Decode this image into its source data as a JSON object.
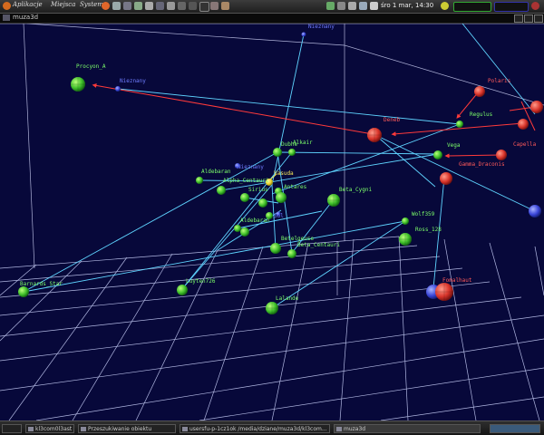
{
  "top_panel": {
    "menus": [
      "Aplikacje",
      "Miejsca",
      "System"
    ],
    "clock": "śro 1 mar, 14:30"
  },
  "window": {
    "title": "muza3d"
  },
  "taskbar": {
    "tasks": [
      "kl3com0l3ast",
      "Przeszukiwanie obiektu",
      "usersfu-p-1cz1ok /media/dziane/muza3d/kl3com...",
      "muza3d"
    ]
  },
  "stars": [
    {
      "name": "Procyon_A",
      "color": "green"
    },
    {
      "name": "Nieznany",
      "color": "blue"
    },
    {
      "name": "Nieznany",
      "color": "blue"
    },
    {
      "name": "Polaris",
      "color": "red"
    },
    {
      "name": "Regulus",
      "color": "green"
    },
    {
      "name": "Deneb",
      "color": "red"
    },
    {
      "name": "Vega",
      "color": "green"
    },
    {
      "name": "Capella",
      "color": "red"
    },
    {
      "name": "Gamma_Draconis",
      "color": "red"
    },
    {
      "name": "Dubhe",
      "color": "green"
    },
    {
      "name": "Alkair",
      "color": "green"
    },
    {
      "name": "Aldebaran",
      "color": "green"
    },
    {
      "name": "Nieznany",
      "color": "blue"
    },
    {
      "name": "Vasuda",
      "color": "yellow"
    },
    {
      "name": "Alpha_Centauri",
      "color": "green"
    },
    {
      "name": "Antares",
      "color": "green"
    },
    {
      "name": "Sirius",
      "color": "green"
    },
    {
      "name": "Beta_Cygni",
      "color": "green"
    },
    {
      "name": "Sol",
      "color": "blue"
    },
    {
      "name": "Wolf359",
      "color": "green"
    },
    {
      "name": "Ross_128",
      "color": "green"
    },
    {
      "name": "Betelgeuse",
      "color": "green"
    },
    {
      "name": "Beta_Centauri",
      "color": "green"
    },
    {
      "name": "Barnards_Star",
      "color": "green"
    },
    {
      "name": "Luyten726",
      "color": "green"
    },
    {
      "name": "Lalande",
      "color": "green"
    },
    {
      "name": "Aldebaran",
      "color": "red"
    },
    {
      "name": "Fomalhaut",
      "color": "red"
    }
  ]
}
